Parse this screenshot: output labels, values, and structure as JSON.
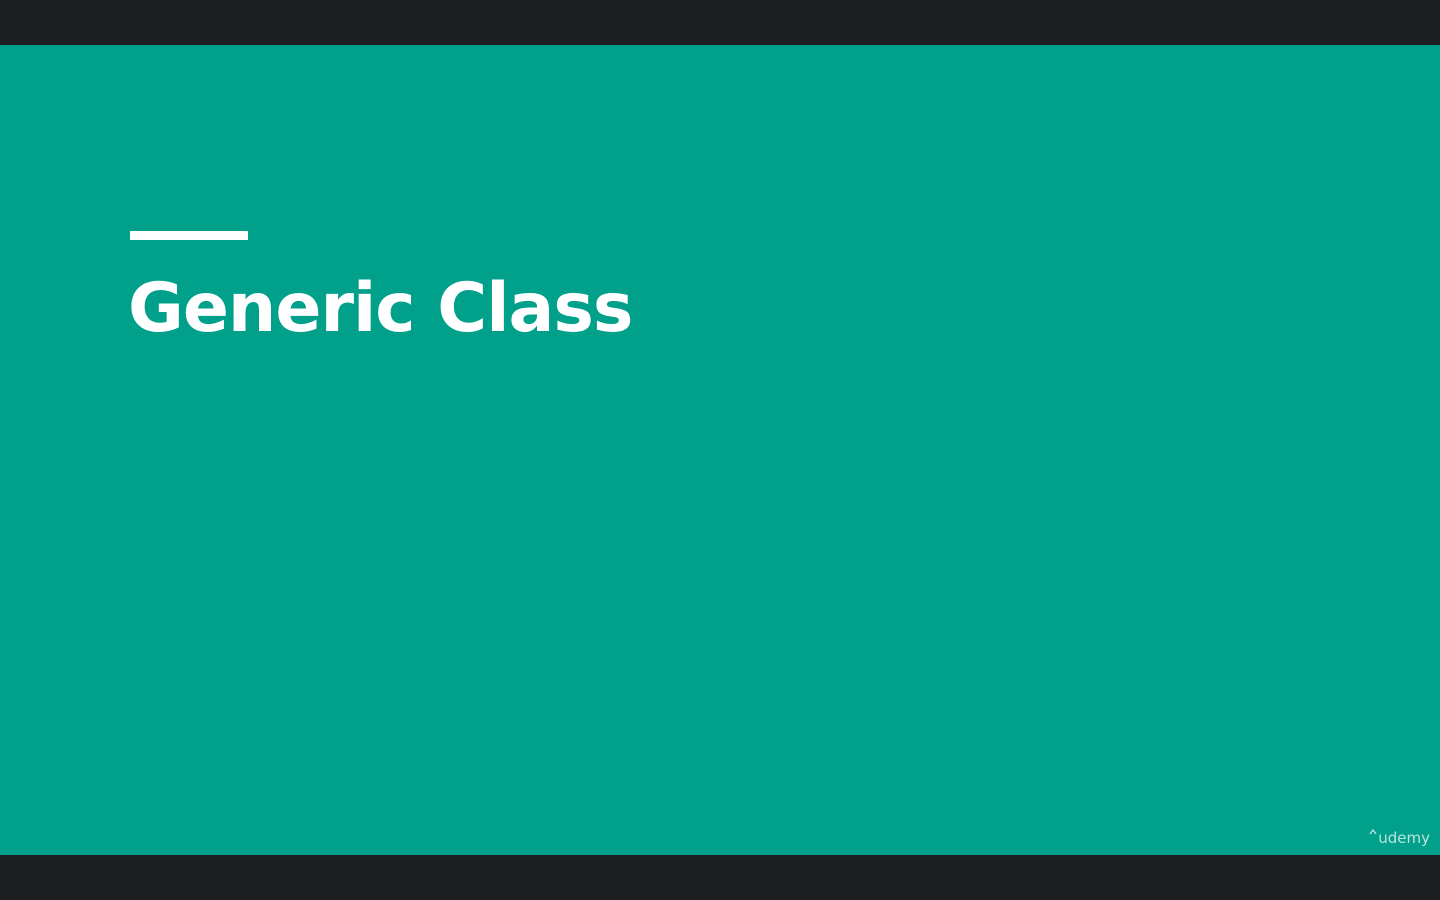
{
  "slide": {
    "title": "Generic Class",
    "background_color": "#00a08a",
    "accent_color": "#ffffff"
  },
  "watermark": {
    "text": "udemy",
    "icon": "udemy-logo-icon"
  },
  "letterbox_color": "#1e1f21"
}
